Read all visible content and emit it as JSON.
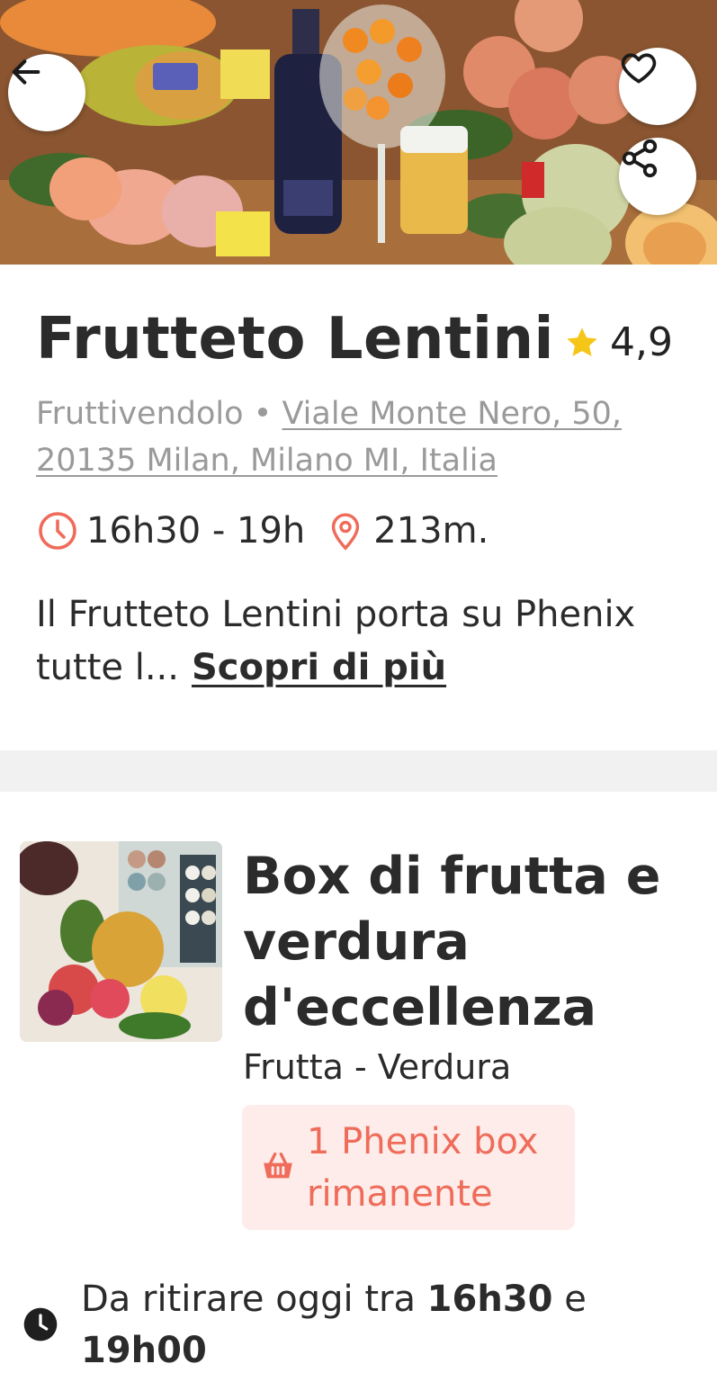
{
  "hero": {
    "image_alt": "fruit display",
    "back_icon": "arrow-left-icon",
    "favorite_icon": "heart-icon",
    "share_icon": "share-icon"
  },
  "store": {
    "name": "Frutteto Lentini",
    "rating": "4,9",
    "rating_icon": "star-icon",
    "category": "Fruttivendolo",
    "separator": "•",
    "address": "Viale Monte Nero, 50, 20135 Milan, Milano MI, Italia",
    "hours": "16h30 - 19h",
    "distance": "213m.",
    "description": "Il Frutteto Lentini porta su Phenix tutte l...",
    "more_link": "Scopri di più"
  },
  "offer": {
    "title": "Box di frutta e verdura d'eccellenza",
    "categories": "Frutta - Verdura",
    "stock": "1 Phenix box rimanente",
    "pickup_prefix": "Da ritirare oggi tra",
    "pickup_start": "16h30",
    "pickup_and": "e",
    "pickup_end": "19h00"
  },
  "colors": {
    "accent_red": "#ef6b5a",
    "badge_bg": "#fdece9",
    "star_yellow": "#f5c518",
    "muted_text": "#9a9a9a"
  }
}
